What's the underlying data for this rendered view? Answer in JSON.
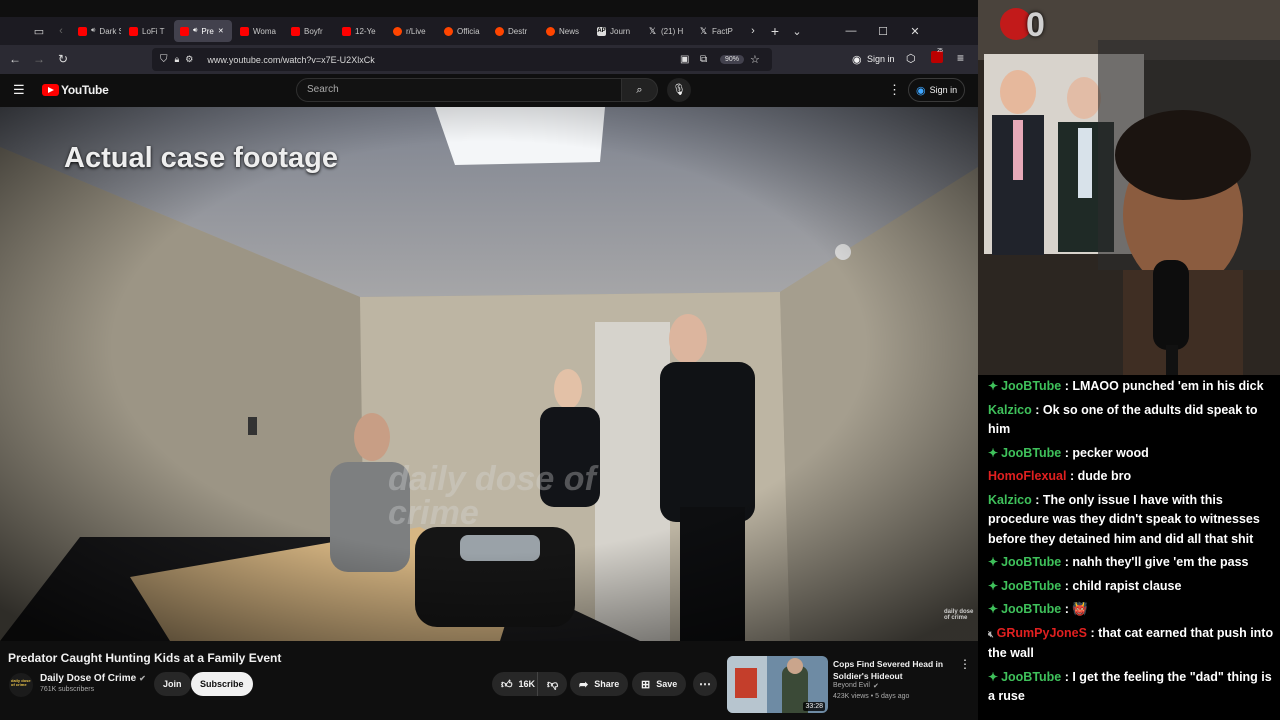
{
  "browser": {
    "tabs": [
      {
        "label": "Dark S",
        "icon": "youtube-favicon",
        "audio": true,
        "active": false
      },
      {
        "label": "LoFi T",
        "icon": "youtube-favicon",
        "audio": false,
        "active": false
      },
      {
        "label": "Pre",
        "icon": "youtube-favicon",
        "audio": true,
        "active": true
      },
      {
        "label": "Woma",
        "icon": "youtube-favicon",
        "audio": false,
        "active": false
      },
      {
        "label": "Boyfr",
        "icon": "youtube-favicon",
        "audio": false,
        "active": false
      },
      {
        "label": "12-Ye",
        "icon": "youtube-favicon",
        "audio": false,
        "active": false
      },
      {
        "label": "r/Live",
        "icon": "reddit-favicon",
        "audio": false,
        "active": false
      },
      {
        "label": "Officia",
        "icon": "reddit-favicon",
        "audio": false,
        "active": false
      },
      {
        "label": "Destr",
        "icon": "reddit-favicon",
        "audio": false,
        "active": false
      },
      {
        "label": "News",
        "icon": "reddit-favicon",
        "audio": false,
        "active": false
      },
      {
        "label": "Journ",
        "icon": "ap-favicon",
        "audio": false,
        "active": false
      },
      {
        "label": "(21) H",
        "icon": "x-favicon",
        "audio": false,
        "active": false
      },
      {
        "label": "FactP",
        "icon": "x-favicon",
        "audio": false,
        "active": false
      }
    ],
    "url": "www.youtube.com/watch?v=x7E-U2XlxCk",
    "zoom": "90%",
    "sign_in": "Sign in",
    "notif_count": "25"
  },
  "youtube": {
    "logo_text": "YouTube",
    "search_placeholder": "Search",
    "sign_in": "Sign in",
    "overlay_text": "Actual case footage",
    "watermark": "daily dose of crime",
    "corner_watermark": "daily dose of crime",
    "video_title": "Predator Caught Hunting Kids at a Family Event",
    "channel_name": "Daily Dose Of Crime",
    "channel_avatar_text": "daily dose of crime",
    "subscribers": "761K subscribers",
    "join": "Join",
    "subscribe": "Subscribe",
    "likes": "16K",
    "share": "Share",
    "save": "Save",
    "rec": {
      "title": "Cops Find Severed Head in Soldier's Hideout",
      "channel": "Beyond Evil",
      "meta": "423K views • 5 days ago",
      "duration": "33:28"
    }
  },
  "stream": {
    "counter": "0",
    "chat": [
      {
        "user": "JooBTube",
        "color": "#3fc15b",
        "badge": true,
        "text": "LMAOO punched 'em in his dick"
      },
      {
        "user": "Kalzico",
        "color": "#3fc15b",
        "badge": false,
        "text": "Ok so one of the adults did speak to him"
      },
      {
        "user": "JooBTube",
        "color": "#3fc15b",
        "badge": true,
        "text": "pecker wood"
      },
      {
        "user": "HomoFlexual",
        "color": "#e02020",
        "badge": false,
        "text": "dude bro"
      },
      {
        "user": "Kalzico",
        "color": "#3fc15b",
        "badge": false,
        "text": "The only issue I have with this procedure was they didn't speak to witnesses before they detained him and did all that shit"
      },
      {
        "user": "JooBTube",
        "color": "#3fc15b",
        "badge": true,
        "text": "nahh they'll give 'em the pass"
      },
      {
        "user": "JooBTube",
        "color": "#3fc15b",
        "badge": true,
        "text": "child rapist clause"
      },
      {
        "user": "JooBTube",
        "color": "#3fc15b",
        "badge": true,
        "text": "👹"
      },
      {
        "user": "GRumPyJoneS",
        "color": "#e02020",
        "badge": false,
        "muted": true,
        "text": "that cat earned that push into the wall"
      },
      {
        "user": "JooBTube",
        "color": "#3fc15b",
        "badge": true,
        "text": "I get the feeling the \"dad\" thing is a ruse"
      }
    ]
  }
}
